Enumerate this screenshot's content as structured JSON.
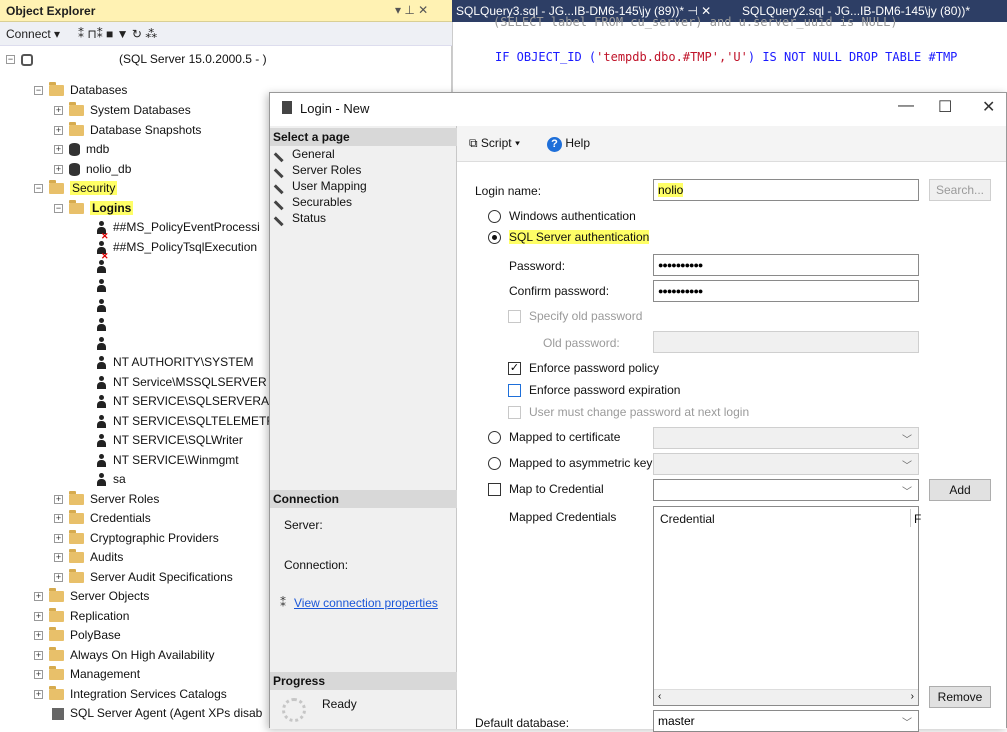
{
  "object_explorer": {
    "title": "Object Explorer",
    "title_controls": "▾ ⊥ ✕",
    "toolbar": {
      "connect": "Connect ▾",
      "icons": "⁑  ⊓⁑  ■  ▼  ↻  ⁂"
    },
    "server_label": "(SQL Server 15.0.2000.5 -                          )",
    "tree": [
      {
        "label": "Databases",
        "indent": 0
      },
      {
        "label": "System Databases",
        "indent": 1
      },
      {
        "label": "Database Snapshots",
        "indent": 1
      },
      {
        "label": "mdb",
        "indent": 1
      },
      {
        "label": "nolio_db",
        "indent": 1
      },
      {
        "label": "Security",
        "indent": 0
      },
      {
        "label": "Logins",
        "indent": 1
      },
      {
        "label": "##MS_PolicyEventProcessi",
        "indent": 2
      },
      {
        "label": "##MS_PolicyTsqlExecution",
        "indent": 2
      },
      {
        "label": "NT AUTHORITY\\SYSTEM",
        "indent": 2
      },
      {
        "label": "NT Service\\MSSQLSERVER",
        "indent": 2
      },
      {
        "label": "NT SERVICE\\SQLSERVERAG",
        "indent": 2
      },
      {
        "label": "NT SERVICE\\SQLTELEMETR",
        "indent": 2
      },
      {
        "label": "NT SERVICE\\SQLWriter",
        "indent": 2
      },
      {
        "label": "NT SERVICE\\Winmgmt",
        "indent": 2
      },
      {
        "label": "sa",
        "indent": 2
      },
      {
        "label": "Server Roles",
        "indent": 1
      },
      {
        "label": "Credentials",
        "indent": 1
      },
      {
        "label": "Cryptographic Providers",
        "indent": 1
      },
      {
        "label": "Audits",
        "indent": 1
      },
      {
        "label": "Server Audit Specifications",
        "indent": 1
      },
      {
        "label": "Server Objects",
        "indent": 0
      },
      {
        "label": "Replication",
        "indent": 0
      },
      {
        "label": "PolyBase",
        "indent": 0
      },
      {
        "label": "Always On High Availability",
        "indent": 0
      },
      {
        "label": "Management",
        "indent": 0
      },
      {
        "label": "Integration Services Catalogs",
        "indent": 0
      },
      {
        "label": "SQL Server Agent (Agent XPs disab",
        "indent": 0
      }
    ]
  },
  "query_tabs": [
    {
      "label": "SQLQuery3.sql - JG...IB-DM6-145\\jy (89))*  ⊣  ✕"
    },
    {
      "label": "SQLQuery2.sql - JG...IB-DM6-145\\jy (80))*"
    }
  ],
  "code": {
    "line1": "(SELECT label FROM cu_server) and u.server_uuid is NULL)",
    "line2_kw": "IF OBJECT_ID (",
    "line2_str": "'tempdb.dbo.#TMP','U'",
    "line2_rest": ") IS NOT NULL DROP TABLE #TMP"
  },
  "dialog": {
    "title": "Login - New",
    "min": "—",
    "max": "☐",
    "close": "✕",
    "select_page": "Select a page",
    "pages": [
      "General",
      "Server Roles",
      "User Mapping",
      "Securables",
      "Status"
    ],
    "connection_header": "Connection",
    "server_label": "Server:",
    "connection_label": "Connection:",
    "view_props": "View connection properties",
    "progress_header": "Progress",
    "progress_status": "Ready",
    "toolbar": {
      "script": "Script",
      "help": "Help"
    },
    "login_name_label": "Login name:",
    "login_name_value": "nolio",
    "search_button": "Search...",
    "windows_auth": "Windows authentication",
    "sql_auth": "SQL Server authentication",
    "password_label": "Password:",
    "password_value": "●●●●●●●●●●",
    "confirm_label": "Confirm password:",
    "confirm_value": "●●●●●●●●●●",
    "specify_old": "Specify old password",
    "old_password_label": "Old password:",
    "enforce_policy": "Enforce password policy",
    "enforce_expiration": "Enforce password expiration",
    "must_change": "User must change password at next login",
    "mapped_cert": "Mapped to certificate",
    "mapped_asym": "Mapped to asymmetric key",
    "map_credential": "Map to Credential",
    "add_button": "Add",
    "mapped_credentials_label": "Mapped Credentials",
    "credential_col": "Credential",
    "credential_col2": "F",
    "remove_button": "Remove",
    "default_db_label": "Default database:",
    "default_db_value": "master"
  }
}
